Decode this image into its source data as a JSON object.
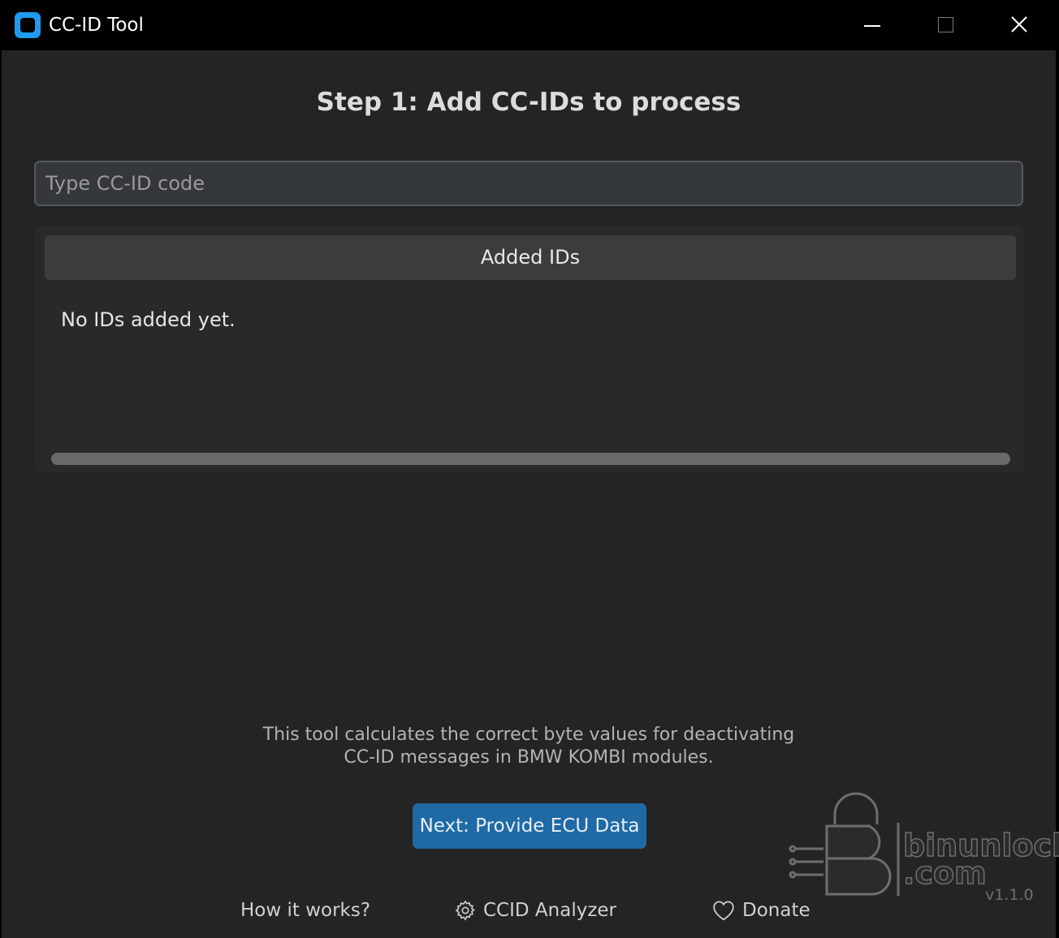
{
  "window": {
    "title": "CC-ID Tool"
  },
  "main": {
    "heading": "Step 1: Add CC-IDs to process",
    "input_placeholder": "Type CC-ID code",
    "input_value": "",
    "ids_header": "Added IDs",
    "ids_empty": "No IDs added yet.",
    "description_line1": "This tool calculates the correct byte values for deactivating",
    "description_line2": "CC-ID messages in BMW KOMBI modules.",
    "next_button": "Next: Provide ECU Data"
  },
  "footer": {
    "how_it_works": "How it works?",
    "ccid_analyzer": "CCID Analyzer",
    "donate": "Donate",
    "version": "v1.1.0",
    "logo_line1": "binunlock",
    "logo_line2": ".com"
  },
  "icons": {
    "app": "app-icon",
    "analyzer": "gear-icon",
    "donate": "heart-icon"
  },
  "colors": {
    "background": "#242424",
    "titlebar": "#000000",
    "accent": "#1f6aa5",
    "app_icon": "#1e9bf0"
  }
}
